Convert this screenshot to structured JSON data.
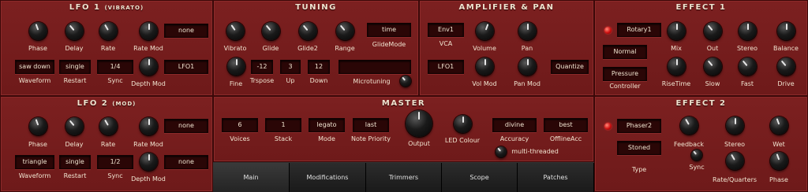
{
  "lfo1": {
    "title": "LFO 1",
    "subtitle": "(VIBRATO)",
    "knobs": {
      "phase": "Phase",
      "delay": "Delay",
      "rate": "Rate",
      "rate_mod": "Rate Mod",
      "depth_mod": "Depth Mod"
    },
    "rate_mod_value": "none",
    "waveform_value": "saw down",
    "waveform_label": "Waveform",
    "restart_value": "single",
    "restart_label": "Restart",
    "sync_value": "1/4",
    "sync_label": "Sync",
    "depth_mod_value": "LFO1"
  },
  "lfo2": {
    "title": "LFO 2",
    "subtitle": "(MOD)",
    "knobs": {
      "phase": "Phase",
      "delay": "Delay",
      "rate": "Rate",
      "rate_mod": "Rate Mod",
      "depth_mod": "Depth Mod"
    },
    "rate_mod_value": "none",
    "waveform_value": "triangle",
    "waveform_label": "Waveform",
    "restart_value": "single",
    "restart_label": "Restart",
    "sync_value": "1/2",
    "sync_label": "Sync",
    "depth_mod_value": "none"
  },
  "tuning": {
    "title": "TUNING",
    "vibrato": "Vibrato",
    "glide": "Glide",
    "glide2": "Glide2",
    "range": "Range",
    "glidemode_value": "time",
    "glidemode_label": "GlideMode",
    "fine": "Fine",
    "trspose_value": "-12",
    "trspose_label": "Trspose",
    "up_value": "3",
    "up_label": "Up",
    "down_value": "12",
    "down_label": "Down",
    "microtuning_value": "",
    "microtuning_label": "Microtuning"
  },
  "amp": {
    "title": "AMPLIFIER & PAN",
    "vca_value": "Env1",
    "vca_label": "VCA",
    "volume": "Volume",
    "pan": "Pan",
    "lfo_value": "LFO1",
    "vol_mod": "Vol Mod",
    "pan_mod": "Pan Mod",
    "quantize": "Quantize"
  },
  "effect1": {
    "title": "EFFECT 1",
    "type_value": "Rotary1",
    "mode_value": "Normal",
    "controller_value": "Pressure",
    "controller_label": "Controller",
    "mix": "Mix",
    "out": "Out",
    "stereo": "Stereo",
    "balance": "Balance",
    "risetime": "RiseTime",
    "slow": "Slow",
    "fast": "Fast",
    "drive": "Drive"
  },
  "master": {
    "title": "MASTER",
    "voices_value": "6",
    "voices_label": "Voices",
    "stack_value": "1",
    "stack_label": "Stack",
    "mode_value": "legato",
    "mode_label": "Mode",
    "priority_value": "last",
    "priority_label": "Note Priority",
    "output": "Output",
    "led_colour": "LED Colour",
    "accuracy_value": "divine",
    "accuracy_label": "Accuracy",
    "offline_value": "best",
    "offline_label": "OfflineAcc",
    "multithreaded": "multi-threaded"
  },
  "effect2": {
    "title": "EFFECT 2",
    "type_value": "Phaser2",
    "mode_value": "Stoned",
    "type_label": "Type",
    "feedback": "Feedback",
    "stereo": "Stereo",
    "wet": "Wet",
    "sync": "Sync",
    "rate_quarters": "Rate/Quarters",
    "phase": "Phase"
  },
  "tabs": [
    "Main",
    "Modifications",
    "Trimmers",
    "Scope",
    "Patches"
  ],
  "active_tab": "Main",
  "colors": {
    "led": "#d01010",
    "panel": "#7a1e1e",
    "display_bg": "#2a0606",
    "text": "#f0e4d0"
  }
}
